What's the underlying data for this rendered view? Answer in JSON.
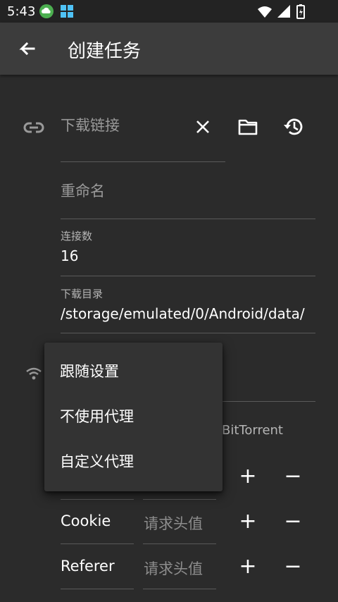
{
  "status_bar": {
    "time": "5:43"
  },
  "app_bar": {
    "title": "创建任务",
    "back_icon": "arrow-back-icon"
  },
  "form": {
    "url_placeholder": "下载链接",
    "rename_placeholder": "重命名",
    "connections_label": "连接数",
    "connections_value": "16",
    "download_dir_label": "下载目录",
    "download_dir_value": "/storage/emulated/0/Android/data/",
    "bittorrent_label": "BitTorrent"
  },
  "proxy_menu": {
    "items": [
      "跟随设置",
      "不使用代理",
      "自定义代理"
    ]
  },
  "headers": {
    "rows": [
      {
        "name": "Cookie",
        "value_placeholder": "请求头值"
      },
      {
        "name": "Referer",
        "value_placeholder": "请求头值"
      }
    ],
    "add_symbol": "+",
    "remove_symbol": "−"
  },
  "colors": {
    "background": "#2b2b2b",
    "app_bar": "#3c3c3c",
    "popup": "#333333",
    "hint": "#9a9a9a"
  }
}
